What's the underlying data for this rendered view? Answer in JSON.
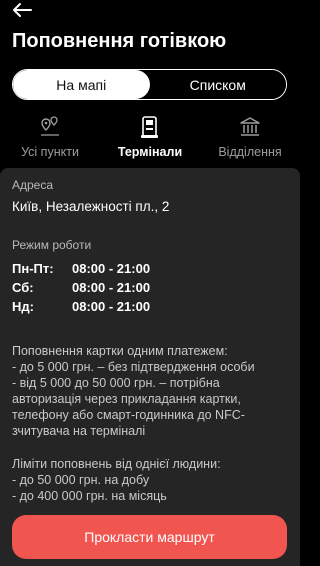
{
  "header": {
    "back_icon": "arrow-left-icon",
    "title": "Поповнення готівкою"
  },
  "view_toggle": {
    "options": [
      {
        "label": "На мапі",
        "active": true
      },
      {
        "label": "Списком",
        "active": false
      }
    ]
  },
  "filters": [
    {
      "label": "Усі пункти",
      "icon": "location-pins-icon",
      "active": false
    },
    {
      "label": "Термінали",
      "icon": "terminal-icon",
      "active": true
    },
    {
      "label": "Відділення",
      "icon": "bank-building-icon",
      "active": false
    }
  ],
  "details": {
    "address_label": "Адреса",
    "address_value": "Київ, Незалежності пл., 2",
    "hours_label": "Режим роботи",
    "schedule": [
      {
        "day": "Пн-Пт:",
        "hours": "08:00 - 21:00"
      },
      {
        "day": "Сб:",
        "hours": "08:00 - 21:00"
      },
      {
        "day": "Нд:",
        "hours": "08:00 - 21:00"
      }
    ],
    "topup_info": "Поповнення картки одним платежем:\n- до 5 000 грн. –  без підтвердження особи\n- від 5 000 до 50 000 грн. – потрібна авторизація через прикладання картки, телефону або смарт-годинника до NFC-зчитувача на терміналі",
    "limits_info": "Ліміти поповнень від однієї людини:\n- до 50 000 грн. на добу\n- до 400 000 грн. на місяць"
  },
  "route_button": {
    "label": "Прокласти маршрут"
  },
  "colors": {
    "accent": "#f0554f",
    "panel": "#252525",
    "background": "#000000"
  }
}
